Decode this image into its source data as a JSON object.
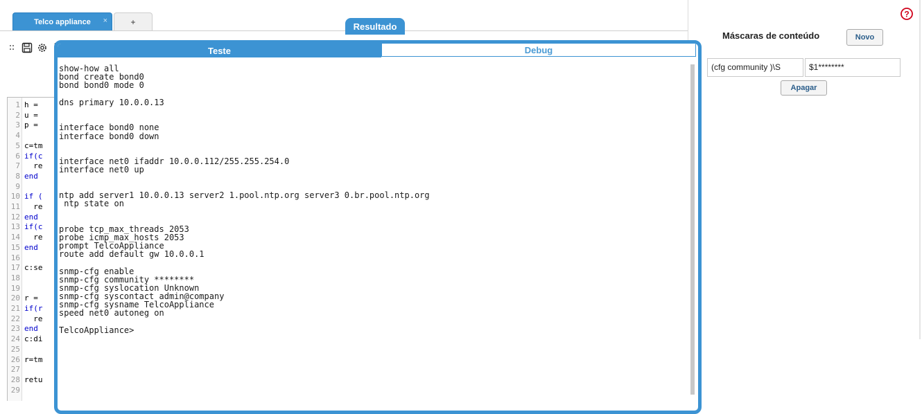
{
  "tabs": {
    "active_label": "Telco appliance",
    "close_glyph": "×",
    "add_label": "+"
  },
  "toolbar": {
    "icons": [
      "drag-handle-icon",
      "save-icon",
      "gear-icon",
      "copy-icon"
    ]
  },
  "code_editor": {
    "lines": [
      {
        "n": "1",
        "t": "h ="
      },
      {
        "n": "2",
        "t": "u ="
      },
      {
        "n": "3",
        "t": "p ="
      },
      {
        "n": "4",
        "t": ""
      },
      {
        "n": "5",
        "t": "c=tm"
      },
      {
        "n": "6",
        "t": "if(c",
        "kw": true
      },
      {
        "n": "7",
        "t": "  re"
      },
      {
        "n": "8",
        "t": "end",
        "kw": true
      },
      {
        "n": "9",
        "t": ""
      },
      {
        "n": "10",
        "t": "if (",
        "kw": true
      },
      {
        "n": "11",
        "t": "  re"
      },
      {
        "n": "12",
        "t": "end",
        "kw": true
      },
      {
        "n": "13",
        "t": "if(c",
        "kw": true
      },
      {
        "n": "14",
        "t": "  re"
      },
      {
        "n": "15",
        "t": "end",
        "kw": true
      },
      {
        "n": "16",
        "t": ""
      },
      {
        "n": "17",
        "t": "c:se"
      },
      {
        "n": "18",
        "t": ""
      },
      {
        "n": "19",
        "t": ""
      },
      {
        "n": "20",
        "t": "r ="
      },
      {
        "n": "21",
        "t": "if(r",
        "kw": true
      },
      {
        "n": "22",
        "t": "  re"
      },
      {
        "n": "23",
        "t": "end",
        "kw": true
      },
      {
        "n": "24",
        "t": "c:di"
      },
      {
        "n": "25",
        "t": ""
      },
      {
        "n": "26",
        "t": "r=tm"
      },
      {
        "n": "27",
        "t": ""
      },
      {
        "n": "28",
        "t": "retu"
      },
      {
        "n": "29",
        "t": ""
      }
    ]
  },
  "result": {
    "label": "Resultado",
    "tab_teste": "Teste",
    "tab_debug": "Debug",
    "output_lines": [
      "show-how all",
      "bond create bond0",
      "bond bond0 mode 0",
      "",
      "dns primary 10.0.0.13",
      "",
      "",
      "interface bond0 none",
      "interface bond0 down",
      "",
      "",
      "interface net0 ifaddr 10.0.0.112/255.255.254.0",
      "interface net0 up",
      "",
      "",
      "ntp add server1 10.0.0.13 server2 1.pool.ntp.org server3 0.br.pool.ntp.org",
      " ntp state on",
      "",
      "",
      "probe tcp_max_threads 2053",
      "probe icmp_max_hosts 2053",
      "prompt TelcoAppliance",
      "route add default gw 10.0.0.1",
      "",
      "snmp-cfg enable",
      "snmp-cfg community ********",
      "snmp-cfg syslocation Unknown",
      "snmp-cfg syscontact admin@company",
      "snmp-cfg sysname TelcoAppliance",
      "speed net0 autoneg on",
      "",
      "TelcoAppliance>"
    ]
  },
  "masks": {
    "title": "Máscaras de conteúdo",
    "new_button": "Novo",
    "pattern_value": "(cfg community )\\S",
    "replace_value": "$1********",
    "delete_button": "Apagar"
  },
  "colors": {
    "accent": "#3c93d3",
    "help_icon": "#d0021b"
  }
}
